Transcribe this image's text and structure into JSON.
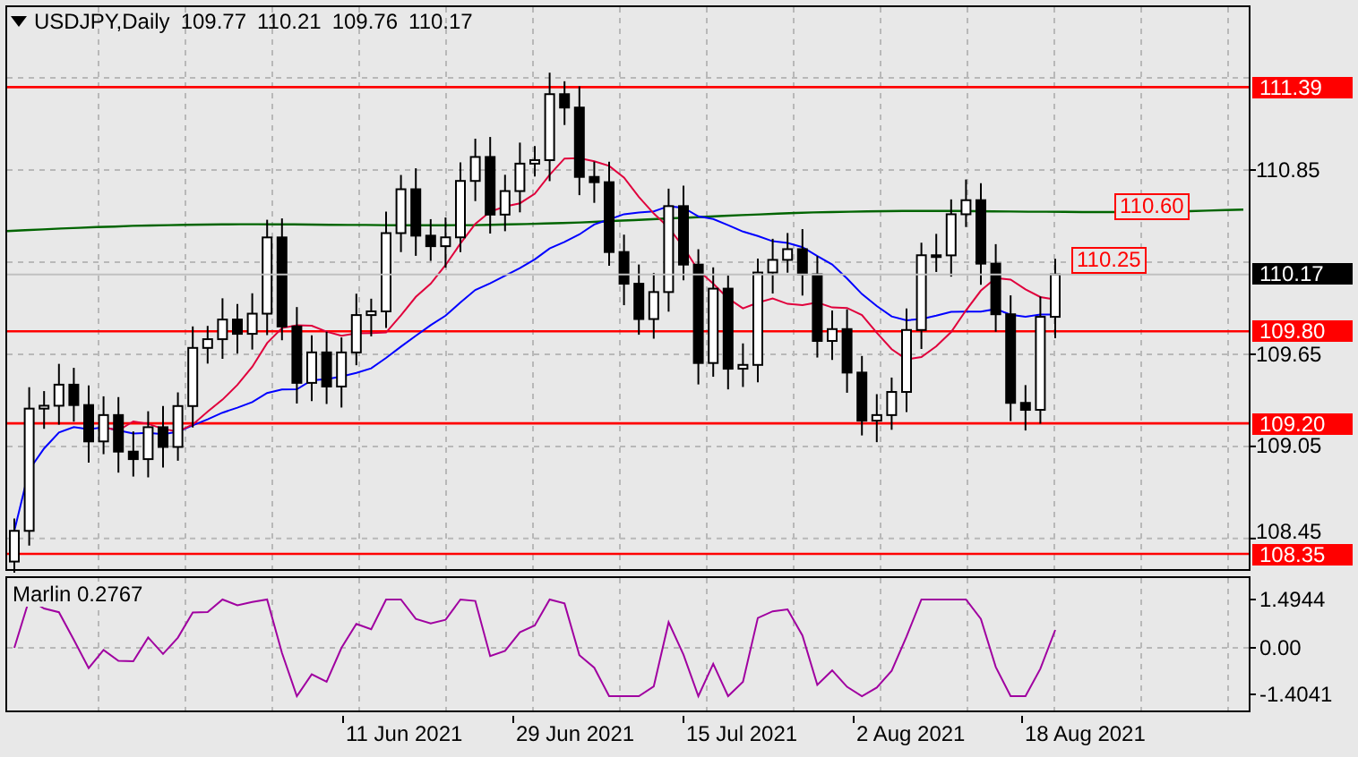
{
  "header": {
    "symbol": "USDJPY,Daily",
    "open": "109.77",
    "high": "110.21",
    "low": "109.76",
    "close": "110.17"
  },
  "price_axis": {
    "ticks": [
      "110.85",
      "109.65",
      "109.05",
      "108.45"
    ]
  },
  "levels": [
    {
      "price": "111.39"
    },
    {
      "price": "109.80"
    },
    {
      "price": "109.20"
    },
    {
      "price": "108.35"
    }
  ],
  "chart_labels": [
    {
      "text": "110.60"
    },
    {
      "text": "110.25"
    }
  ],
  "current_price": "110.17",
  "indicator": {
    "name": "Marlin 0.2767",
    "ticks": [
      "1.4944",
      "0.00",
      "-1.4041"
    ]
  },
  "date_axis": [
    "11 Jun 2021",
    "29 Jun 2021",
    "15 Jul 2021",
    "2 Aug 2021",
    "18 Aug 2021"
  ]
}
